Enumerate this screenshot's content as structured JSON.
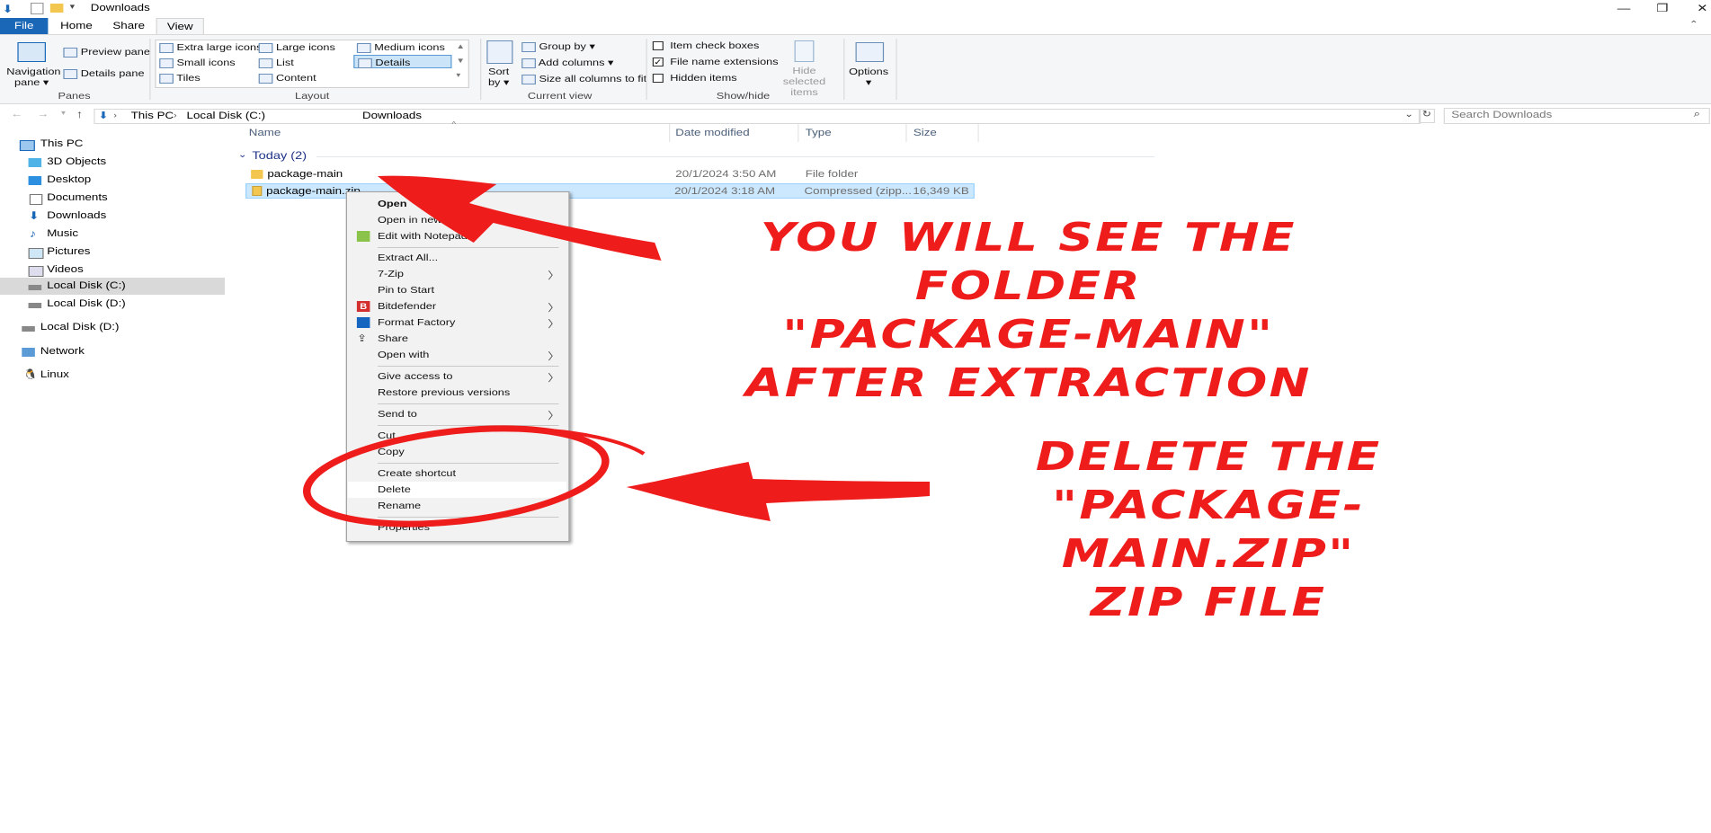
{
  "window": {
    "title": "Downloads"
  },
  "ribbon": {
    "tabs": [
      "File",
      "Home",
      "Share",
      "View"
    ],
    "panes": {
      "navigation_pane": [
        "Navigation",
        "pane"
      ],
      "preview_pane": "Preview pane",
      "details_pane": "Details pane",
      "group_label": "Panes"
    },
    "layout": {
      "options": [
        "Extra large icons",
        "Large icons",
        "Medium icons",
        "Small icons",
        "List",
        "Details",
        "Tiles",
        "Content"
      ],
      "selected": "Details",
      "group_label": "Layout"
    },
    "current_view": {
      "sort_by": [
        "Sort",
        "by"
      ],
      "group_by": "Group by",
      "add_columns": "Add columns",
      "size_all_columns": "Size all columns to fit",
      "group_label": "Current view"
    },
    "show_hide": {
      "item_check_boxes": "Item check boxes",
      "file_name_extensions": "File name extensions",
      "hidden_items": "Hidden items",
      "hide_selected": [
        "Hide selected",
        "items"
      ],
      "group_label": "Show/hide"
    },
    "options_label": "Options"
  },
  "address": {
    "crumbs": [
      "This PC",
      "Local Disk (C:)",
      "Downloads"
    ],
    "search_placeholder": "Search Downloads"
  },
  "nav": {
    "items": [
      {
        "label": "This PC",
        "icon": "computer-icon"
      },
      {
        "label": "3D Objects",
        "icon": "cube-icon"
      },
      {
        "label": "Desktop",
        "icon": "desktop-icon"
      },
      {
        "label": "Documents",
        "icon": "document-icon"
      },
      {
        "label": "Downloads",
        "icon": "download-arrow-icon"
      },
      {
        "label": "Music",
        "icon": "music-note-icon"
      },
      {
        "label": "Pictures",
        "icon": "picture-icon"
      },
      {
        "label": "Videos",
        "icon": "video-icon"
      },
      {
        "label": "Local Disk (C:)",
        "icon": "drive-icon"
      },
      {
        "label": "Local Disk (D:)",
        "icon": "drive-icon"
      },
      {
        "label": "Local Disk (D:)",
        "icon": "drive-icon"
      },
      {
        "label": "Network",
        "icon": "network-icon"
      },
      {
        "label": "Linux",
        "icon": "penguin-icon"
      }
    ],
    "selected": "Local Disk (C:)"
  },
  "files": {
    "columns": [
      "Name",
      "Date modified",
      "Type",
      "Size"
    ],
    "group": "Today (2)",
    "rows": [
      {
        "name": "package-main",
        "date": "20/1/2024 3:50 AM",
        "type": "File folder",
        "size": ""
      },
      {
        "name": "package-main.zip",
        "date": "20/1/2024 3:18 AM",
        "type": "Compressed (zipp...",
        "size": "16,349 KB"
      }
    ]
  },
  "context_menu": {
    "items": [
      "Open",
      "Open in new window",
      "Edit with Notepad++",
      "Extract All...",
      "7-Zip",
      "Pin to Start",
      "Bitdefender",
      "Format Factory",
      "Share",
      "Open with",
      "Give access to",
      "Restore previous versions",
      "Send to",
      "Cut",
      "Copy",
      "Create shortcut",
      "Delete",
      "Rename",
      "Properties"
    ]
  },
  "annotations": {
    "top": [
      "YOU WILL SEE THE FOLDER",
      "\"PACKAGE-MAIN\"",
      "AFTER EXTRACTION"
    ],
    "bottom": [
      "DELETE THE",
      "\"PACKAGE-MAIN.ZIP\"",
      "ZIP FILE"
    ],
    "color": "#ef1c1c"
  }
}
